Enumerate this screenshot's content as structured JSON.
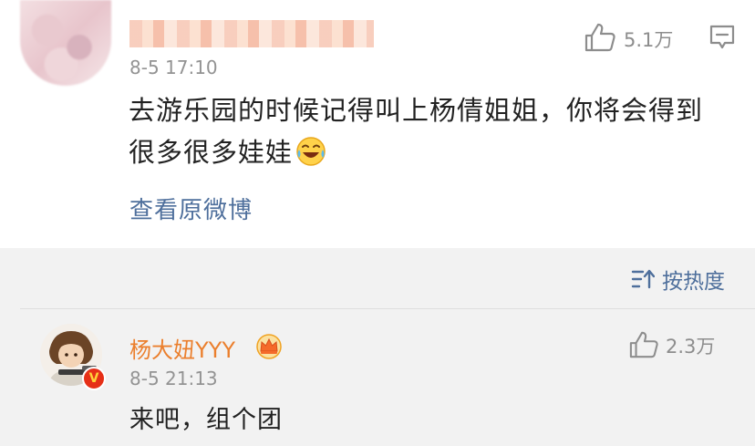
{
  "top_comment": {
    "timestamp": "8-5 17:10",
    "likes": "5.1万",
    "text_line1": "去游乐园的时候记得叫上杨倩姐姐，你将会得到",
    "text_line2": "很多很多娃娃",
    "view_original": "查看原微博"
  },
  "sort": {
    "label": "按热度"
  },
  "reply": {
    "username": "杨大妞YYY",
    "timestamp": "8-5 21:13",
    "likes": "2.3万",
    "text": "来吧，组个团"
  },
  "colors": {
    "link_blue": "#4e6f9c",
    "username_orange": "#eb7f2d",
    "verified_red": "#e62f17"
  },
  "icons": {
    "thumbs_up": "thumbs-up-icon",
    "comment": "comment-bubble-icon",
    "sort": "sort-icon",
    "emoji": "laughing-crying-emoji-icon",
    "crown": "crown-badge-icon",
    "verified": "verified-badge-icon"
  }
}
